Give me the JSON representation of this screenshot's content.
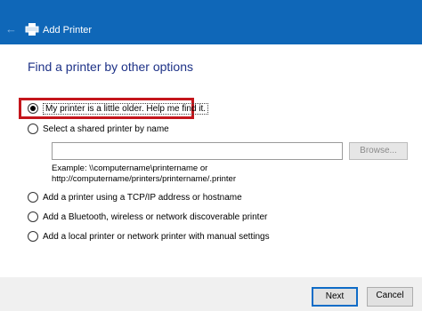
{
  "window": {
    "title": "Add Printer",
    "back_icon": "←"
  },
  "heading": "Find a printer by other options",
  "options": [
    {
      "label": "My printer is a little older. Help me find it.",
      "selected": true
    },
    {
      "label": "Select a shared printer by name",
      "selected": false
    },
    {
      "label": "Add a printer using a TCP/IP address or hostname",
      "selected": false
    },
    {
      "label": "Add a Bluetooth, wireless or network discoverable printer",
      "selected": false
    },
    {
      "label": "Add a local printer or network printer with manual settings",
      "selected": false
    }
  ],
  "shared": {
    "value": "",
    "browse_label": "Browse...",
    "example_line1": "Example: \\\\computername\\printername or",
    "example_line2": "http://computername/printers/printername/.printer"
  },
  "footer": {
    "next_label": "Next",
    "cancel_label": "Cancel"
  },
  "colors": {
    "titlebar": "#0f67b8",
    "heading": "#1e3287",
    "highlight": "#c4161c"
  },
  "icons": {
    "back": "back-arrow-icon",
    "printer": "printer-icon"
  }
}
